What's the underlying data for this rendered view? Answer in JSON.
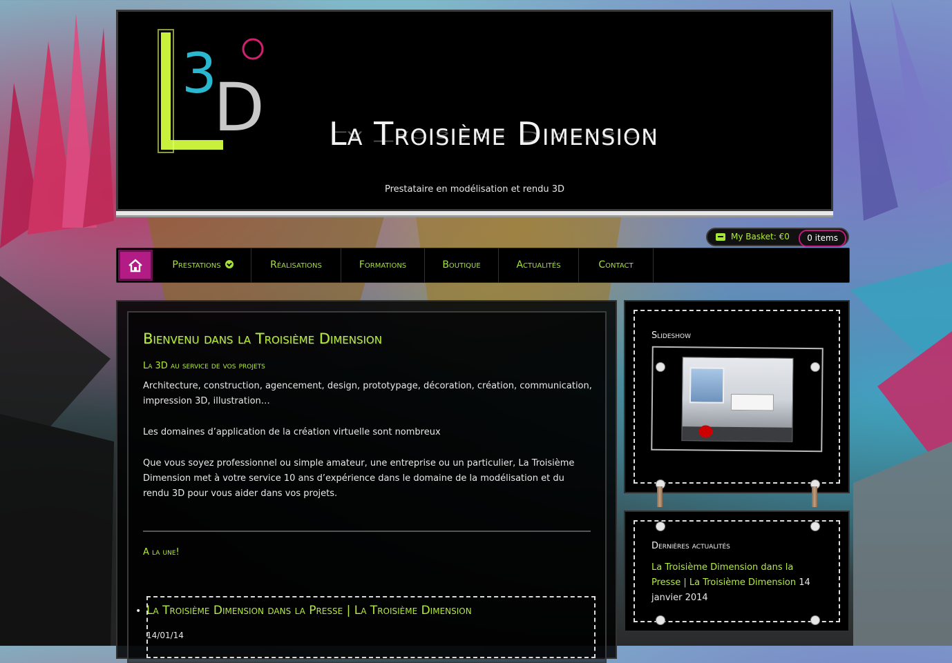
{
  "header": {
    "site_title": "La Troisième Dimension",
    "tagline": "Prestataire en modélisation et rendu 3D",
    "logo_icon": "l3d-logo"
  },
  "basket": {
    "label": "My Basket: €0",
    "items": "0 items",
    "icon": "basket-icon"
  },
  "nav": {
    "home_icon": "home-icon",
    "items": [
      {
        "label": "Prestations"
      },
      {
        "label": "Réalisations"
      },
      {
        "label": "Formations"
      },
      {
        "label": "Boutique"
      },
      {
        "label": "Actualités"
      },
      {
        "label": "Contact"
      }
    ]
  },
  "main": {
    "heading": "Bienvenu dans la Troisième Dimension",
    "subheading": "La 3D au service de vos projets",
    "paragraphs": [
      "Architecture, construction, agencement, design, prototypage, décoration, création, communication, impression 3D, illustration…",
      "Les domaines d’application de la création virtuelle sont nombreux",
      "Que vous soyez professionnel ou simple amateur, une entreprise ou un particulier,  La Troisième Dimension met à votre service 10 ans d’expérience dans le domaine de la modélisation et du rendu 3D pour vous aider dans vos projets."
    ],
    "une_heading": "A la une!",
    "news": {
      "title": "La Troisième Dimension dans la Presse | La Troisième Dimension",
      "date": "14/01/14"
    }
  },
  "sidebar": {
    "slideshow": {
      "title": "Slideshow"
    },
    "latest": {
      "title": "Dernières actualités",
      "link": "La Troisième Dimension dans la Presse | La Troisième Dimension",
      "date": " 14 janvier 2014"
    }
  },
  "colors": {
    "accent": "#b4ec3c",
    "magenta": "#b41c85",
    "background": "#000000"
  }
}
